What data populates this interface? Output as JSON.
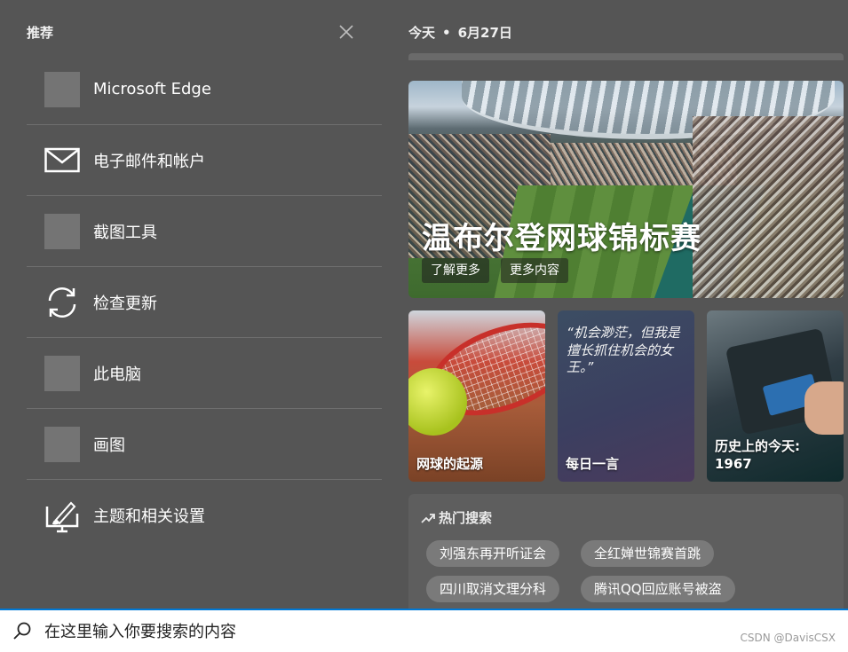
{
  "recommended": {
    "title": "推荐",
    "items": [
      {
        "label": "Microsoft Edge",
        "icon": "app-placeholder-icon"
      },
      {
        "label": "电子邮件和帐户",
        "icon": "mail-icon"
      },
      {
        "label": "截图工具",
        "icon": "app-placeholder-icon"
      },
      {
        "label": "检查更新",
        "icon": "sync-icon"
      },
      {
        "label": "此电脑",
        "icon": "app-placeholder-icon"
      },
      {
        "label": "画图",
        "icon": "app-placeholder-icon"
      },
      {
        "label": "主题和相关设置",
        "icon": "paint-brush-icon"
      }
    ]
  },
  "today": {
    "label": "今天",
    "date": "6月27日"
  },
  "hero": {
    "title": "温布尔登网球锦标赛",
    "buttons": [
      "了解更多",
      "更多内容"
    ]
  },
  "tiles": [
    {
      "label": "网球的起源"
    },
    {
      "quote": "“机会渺茫，但我是擅长抓住机会的女王。”",
      "label": "每日一言"
    },
    {
      "label": "历史上的今天:",
      "sublabel": "1967"
    }
  ],
  "trending": {
    "title": "热门搜索",
    "chips": [
      "刘强东再开听证会",
      "全红婵世锦赛首跳",
      "四川取消文理分科",
      "腾讯QQ回应账号被盗"
    ]
  },
  "search": {
    "placeholder": "在这里输入你要搜索的内容"
  },
  "watermark": "CSDN @DavisCSX",
  "colors": {
    "background": "#555555",
    "accent": "#0078d4"
  }
}
